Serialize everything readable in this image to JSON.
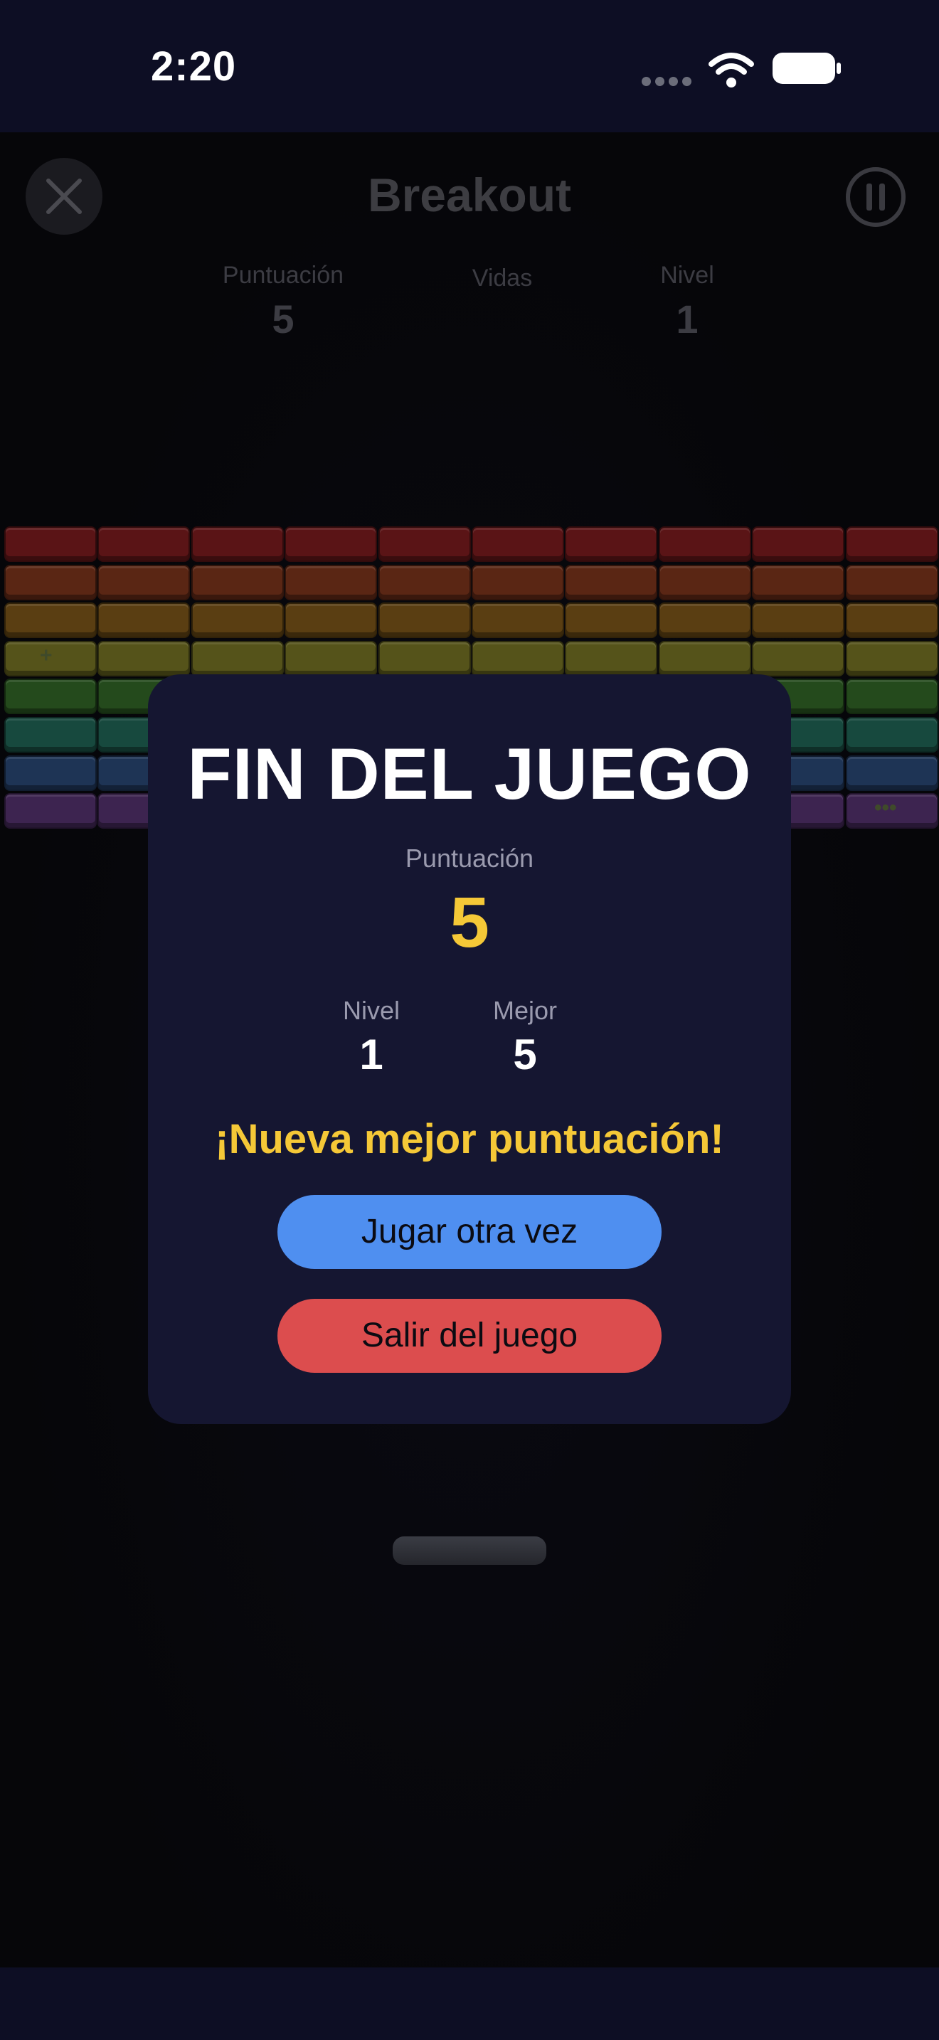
{
  "status_bar": {
    "time": "2:20",
    "signal_icon": "cellular-dots-icon",
    "wifi_icon": "wifi-icon",
    "battery_icon": "battery-full-icon"
  },
  "header": {
    "title": "Breakout",
    "close_icon": "close-icon",
    "pause_icon": "pause-icon"
  },
  "hud": {
    "score_label": "Puntuación",
    "score_value": "5",
    "lives_label": "Vidas",
    "level_label": "Nivel",
    "level_value": "1"
  },
  "bricks": {
    "rows": 8,
    "columns": 10,
    "row_colors": [
      "#5a1416",
      "#5a2614",
      "#5a3e12",
      "#55531a",
      "#244a1c",
      "#17493e",
      "#1e3455",
      "#3d2450"
    ],
    "marks": [
      {
        "row": 3,
        "col": 0,
        "symbol": "+"
      },
      {
        "row": 7,
        "col": 9,
        "symbol": "•••"
      }
    ]
  },
  "game_over": {
    "title": "FIN DEL JUEGO",
    "score_label": "Puntuación",
    "score_value": "5",
    "level_label": "Nivel",
    "level_value": "1",
    "best_label": "Mejor",
    "best_value": "5",
    "new_record_message": "¡Nueva mejor puntuación!",
    "play_again_label": "Jugar otra vez",
    "exit_label": "Salir del juego",
    "accent_color": "#f5c837",
    "play_again_color": "#4f8ff0",
    "exit_color": "#dc4d4e"
  }
}
